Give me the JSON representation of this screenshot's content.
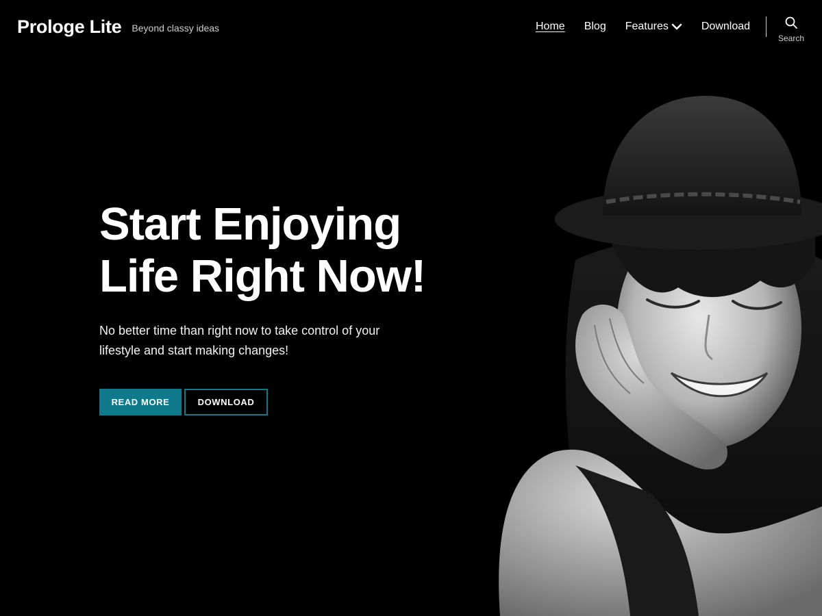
{
  "site": {
    "title": "Prologe Lite",
    "tagline": "Beyond classy ideas"
  },
  "nav": {
    "items": [
      {
        "label": "Home",
        "current": true
      },
      {
        "label": "Blog"
      },
      {
        "label": "Features",
        "has_submenu": true
      },
      {
        "label": "Download"
      }
    ],
    "search_label": "Search"
  },
  "hero": {
    "title_line1": "Start Enjoying",
    "title_line2": "Life Right Now!",
    "text": "No better time than right now to take control of your lifestyle and start making changes!",
    "primary_button": "READ MORE",
    "secondary_button": "DOWNLOAD"
  },
  "colors": {
    "background": "#000000",
    "accent": "#0f7a8c",
    "text": "#ffffff"
  },
  "icons": {
    "search": "search-icon",
    "submenu": "chevron-down-icon"
  }
}
